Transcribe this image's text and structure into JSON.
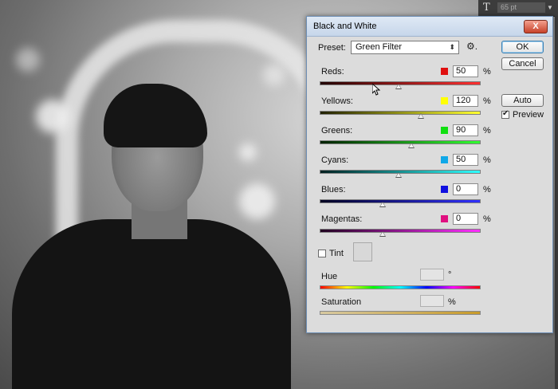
{
  "topbar": {
    "font_icon": "T",
    "font_size": "65 pt"
  },
  "dialog": {
    "title": "Black and White",
    "close_symbol": "X",
    "preset_label": "Preset:",
    "preset_value": "Green Filter",
    "buttons": {
      "ok": "OK",
      "cancel": "Cancel",
      "auto": "Auto"
    },
    "preview_label": "Preview",
    "preview_checked": true,
    "channels": [
      {
        "label": "Reds:",
        "value": "50",
        "unit": "%",
        "color": "#e01010",
        "slider_fraction": 0.495,
        "grad": "linear-gradient(to right,#200000,#ff3030)"
      },
      {
        "label": "Yellows:",
        "value": "120",
        "unit": "%",
        "color": "#ffff00",
        "slider_fraction": 0.635,
        "grad": "linear-gradient(to right,#202000,#ffff30)"
      },
      {
        "label": "Greens:",
        "value": "90",
        "unit": "%",
        "color": "#10e010",
        "slider_fraction": 0.575,
        "grad": "linear-gradient(to right,#002000,#30ff30)"
      },
      {
        "label": "Cyans:",
        "value": "50",
        "unit": "%",
        "color": "#10a8e8",
        "slider_fraction": 0.495,
        "grad": "linear-gradient(to right,#002020,#30ffff)"
      },
      {
        "label": "Blues:",
        "value": "0",
        "unit": "%",
        "color": "#1010e0",
        "slider_fraction": 0.395,
        "grad": "linear-gradient(to right,#000020,#3030ff)"
      },
      {
        "label": "Magentas:",
        "value": "0",
        "unit": "%",
        "color": "#e01080",
        "slider_fraction": 0.395,
        "grad": "linear-gradient(to right,#200020,#ff30ff)"
      }
    ],
    "tint_label": "Tint",
    "tint_checked": false,
    "hue_label": "Hue",
    "hue_unit": "°",
    "saturation_label": "Saturation",
    "saturation_unit": "%"
  }
}
